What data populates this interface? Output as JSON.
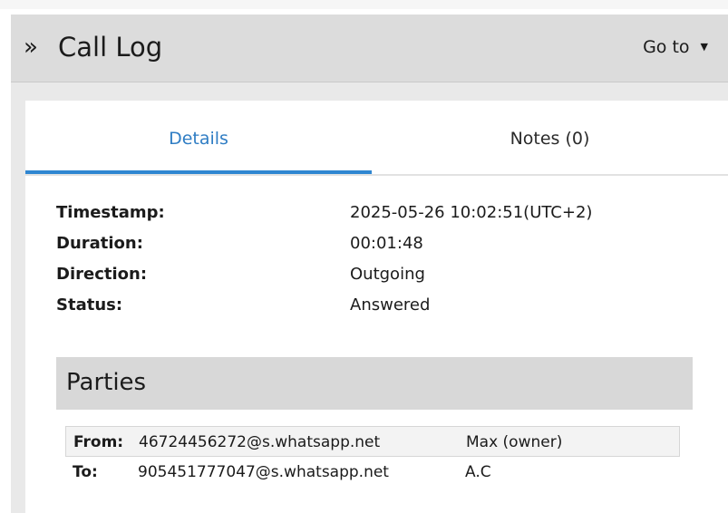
{
  "header": {
    "chevron": "»",
    "title": "Call Log",
    "goto_label": "Go to",
    "goto_caret": "▼"
  },
  "tabs": [
    {
      "label": "Details",
      "active": true
    },
    {
      "label": "Notes (0)",
      "active": false
    }
  ],
  "details": [
    {
      "label": "Timestamp:",
      "value": "2025-05-26 10:02:51(UTC+2)"
    },
    {
      "label": "Duration:",
      "value": "00:01:48"
    },
    {
      "label": "Direction:",
      "value": "Outgoing"
    },
    {
      "label": "Status:",
      "value": "Answered"
    }
  ],
  "parties": {
    "title": "Parties",
    "rows": [
      {
        "role": "From:",
        "address": "46724456272@s.whatsapp.net",
        "name": "Max (owner)"
      },
      {
        "role": "To:",
        "address": "905451777047@s.whatsapp.net",
        "name": "A.C"
      }
    ]
  },
  "colors": {
    "accent": "#2f86d1",
    "header_bg": "#dcdcdc",
    "section_bg": "#d8d8d8"
  }
}
